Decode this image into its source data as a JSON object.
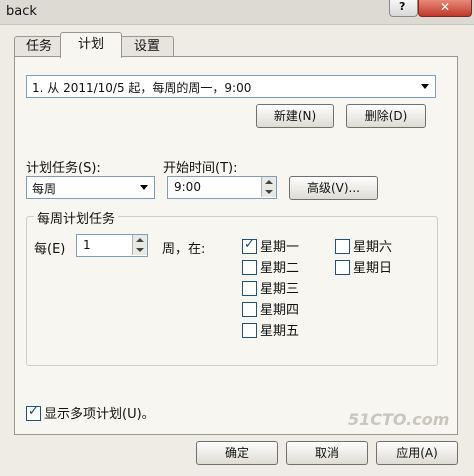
{
  "window": {
    "title": "back"
  },
  "tabs": [
    {
      "label": "任务"
    },
    {
      "label": "计划"
    },
    {
      "label": "设置"
    }
  ],
  "schedule": {
    "summary": "1. 从 2011/10/5 起，每周的周一，9:00",
    "new_label": "新建(N)",
    "delete_label": "删除(D)"
  },
  "task": {
    "label": "计划任务(S):",
    "value": "每周"
  },
  "start": {
    "label": "开始时间(T):",
    "value": "9:00"
  },
  "advanced_label": "高级(V)...",
  "weekly": {
    "legend": "每周计划任务",
    "every_label": "每(E)",
    "every_value": "1",
    "on_label": "周，在:",
    "days": [
      {
        "label": "星期一",
        "checked": true
      },
      {
        "label": "星期二",
        "checked": false
      },
      {
        "label": "星期三",
        "checked": false
      },
      {
        "label": "星期四",
        "checked": false
      },
      {
        "label": "星期五",
        "checked": false
      },
      {
        "label": "星期六",
        "checked": false
      },
      {
        "label": "星期日",
        "checked": false
      }
    ]
  },
  "show_multiple": {
    "label": "显示多项计划(U)。",
    "checked": true
  },
  "footer": {
    "ok_label": "确定",
    "cancel_label": "取消",
    "apply_label": "应用(A)"
  },
  "watermark": "51CTO.com"
}
